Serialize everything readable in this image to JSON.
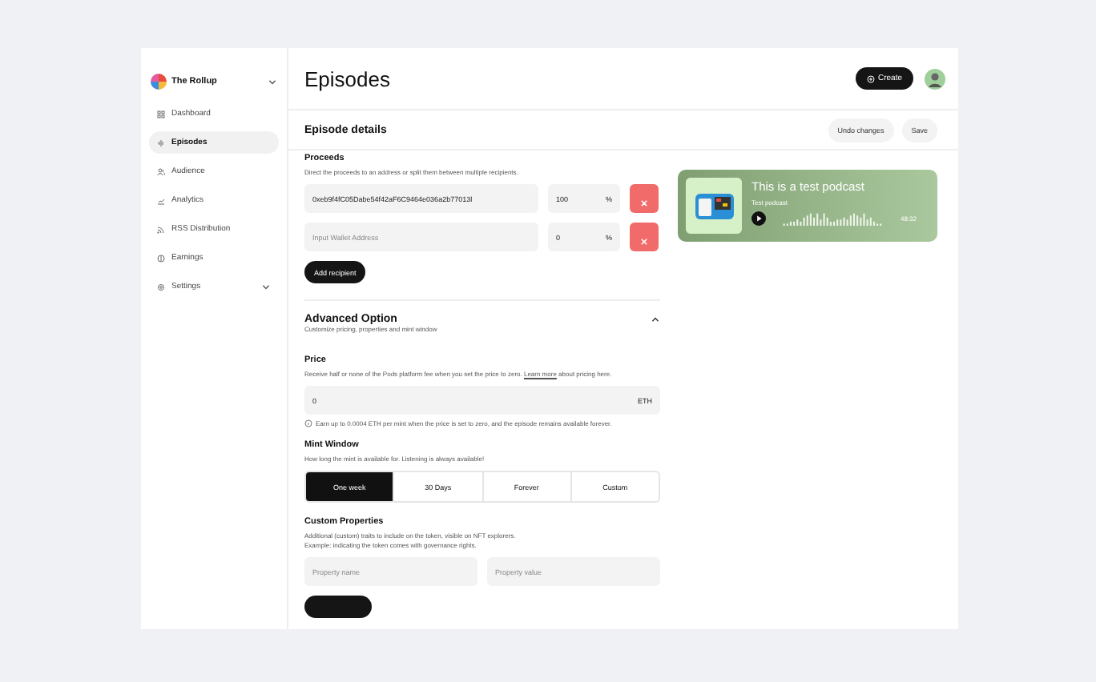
{
  "brand": {
    "name": "The Rollup"
  },
  "sidebar": {
    "items": [
      {
        "label": "Dashboard",
        "selected": false
      },
      {
        "label": "Episodes",
        "selected": true
      },
      {
        "label": "Audience",
        "selected": false
      },
      {
        "label": "Analytics",
        "selected": false
      },
      {
        "label": "RSS Distribution",
        "selected": false
      },
      {
        "label": "Earnings",
        "selected": false
      },
      {
        "label": "Settings",
        "selected": false,
        "expanded": false
      }
    ]
  },
  "header": {
    "title": "Episodes",
    "create": "Create"
  },
  "details": {
    "title": "Episode details",
    "undo": "Undo changes",
    "save": "Save"
  },
  "proceeds": {
    "title": "Proceeds",
    "description": "Direct the proceeds to an address or split them between multiple recipients.",
    "recipients": [
      {
        "address": "0xeb9f4fC05Dabe54f42aF6C9464e036a2b77013l",
        "share": "100",
        "unit": "%"
      },
      {
        "address_placeholder": "Input Wallet Address",
        "share": "0",
        "unit": "%"
      }
    ],
    "add": "Add recipient"
  },
  "advanced": {
    "title": "Advanced Option",
    "description": "Customize pricing, properties and mint window",
    "expanded": true
  },
  "price": {
    "title": "Price",
    "description": "Receive half or none of the Pods platform fee when you set the price to zero.",
    "link": "Learn more",
    "description_end": "about pricing here.",
    "value": "0",
    "unit": "ETH",
    "info": "Earn up to 0.0004 ETH per mint when the price is set to zero, and the episode remains available forever."
  },
  "mint_window": {
    "title": "Mint Window",
    "description": "How long the mint is available for. Listening is always available!",
    "options": [
      {
        "label": "One week",
        "selected": true
      },
      {
        "label": "30 Days",
        "selected": false
      },
      {
        "label": "Forever",
        "selected": false
      },
      {
        "label": "Custom",
        "selected": false
      }
    ]
  },
  "custom_properties": {
    "title": "Custom Properties",
    "description": "Additional (custom) traits to include on the token, visible on NFT explorers.",
    "example": "Example: indicating the token comes with governance rights.",
    "name_placeholder": "Property name",
    "value_placeholder": "Property value"
  },
  "podcast": {
    "title": "This is a test podcast",
    "subtitle": "Test podcast",
    "time": "48:32"
  }
}
